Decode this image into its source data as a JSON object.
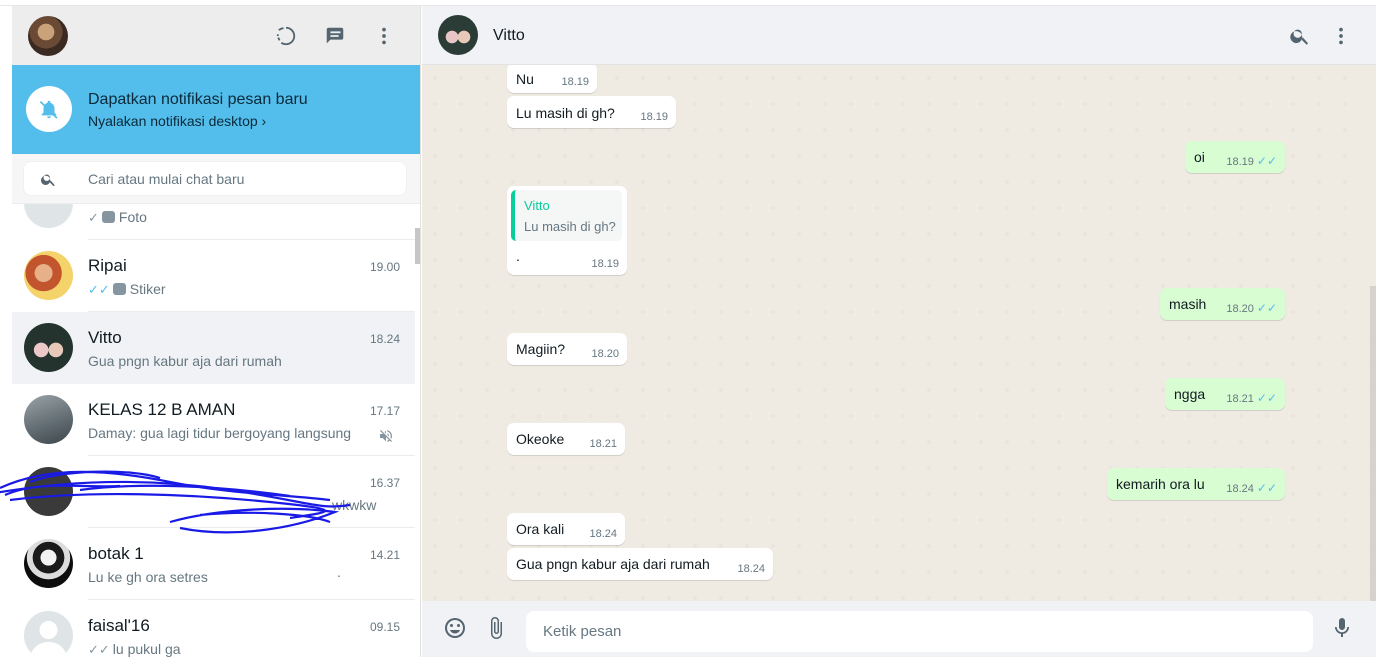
{
  "sidebar": {
    "notification": {
      "title": "Dapatkan notifikasi pesan baru",
      "subtitle": "Nyalakan notifikasi desktop"
    },
    "search": {
      "placeholder": "Cari atau mulai chat baru"
    },
    "chats": [
      {
        "name": "",
        "time": "",
        "preview": "Foto",
        "status": "sent"
      },
      {
        "name": "Ripai",
        "time": "19.00",
        "preview": "Stiker",
        "status": "read"
      },
      {
        "name": "Vitto",
        "time": "18.24",
        "preview": "Gua pngn kabur aja dari rumah",
        "active": true
      },
      {
        "name": "KELAS 12 B AMAN",
        "time": "17.17",
        "preview": "Damay: gua lagi tidur bergoyang langsung",
        "muted": true
      },
      {
        "name": "",
        "time": "16.37",
        "preview": "wkwkw",
        "redacted": true
      },
      {
        "name": "botak 1",
        "time": "14.21",
        "preview": "Lu ke gh ora setres",
        "extra": "."
      },
      {
        "name": "faisal'16",
        "time": "09.15",
        "preview": "lu pukul ga",
        "status": "delivered"
      }
    ]
  },
  "conversation": {
    "contact_name": "Vitto",
    "messages": [
      {
        "dir": "in",
        "text": "Nu",
        "time": "18.19"
      },
      {
        "dir": "in",
        "text": "Lu masih di gh?",
        "time": "18.19"
      },
      {
        "dir": "out",
        "text": "oi",
        "time": "18.19",
        "status": "read"
      },
      {
        "dir": "in",
        "text": ".",
        "time": "18.19",
        "reply_to": {
          "name": "Vitto",
          "text": "Lu masih di gh?"
        }
      },
      {
        "dir": "out",
        "text": "masih",
        "time": "18.20",
        "status": "read"
      },
      {
        "dir": "in",
        "text": "Magiin?",
        "time": "18.20"
      },
      {
        "dir": "out",
        "text": "ngga",
        "time": "18.21",
        "status": "read"
      },
      {
        "dir": "in",
        "text": "Okeoke",
        "time": "18.21"
      },
      {
        "dir": "out",
        "text": "kemarih ora lu",
        "time": "18.24",
        "status": "read"
      },
      {
        "dir": "in",
        "text": "Ora kali",
        "time": "18.24"
      },
      {
        "dir": "in",
        "text": "Gua pngn kabur aja dari rumah",
        "time": "18.24"
      }
    ],
    "composer": {
      "placeholder": "Ketik pesan"
    }
  },
  "glyphs": {
    "read_tick": "✓✓",
    "sent_tick": "✓",
    "chevron": "›"
  },
  "colors": {
    "accent": "#53bdeb",
    "outgoing_bubble": "#d9fdd3",
    "chat_bg": "#efeae2",
    "reply_green": "#06cf9c"
  }
}
